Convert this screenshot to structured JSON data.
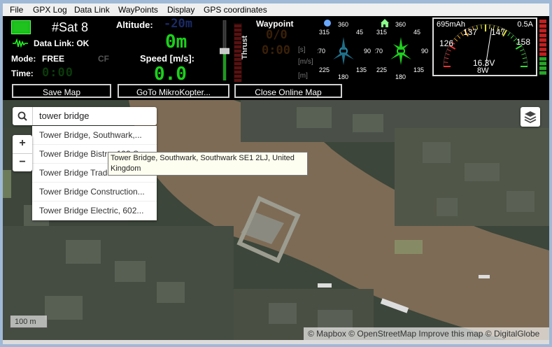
{
  "menu": [
    "File",
    "GPX Log",
    "Data Link",
    "WayPoints",
    "Display",
    "GPS coordinates"
  ],
  "status": {
    "sat": "#Sat 8",
    "data_link": "Data Link: OK",
    "mode_label": "Mode:",
    "mode_value": "FREE",
    "cf": "CF",
    "time_label": "Time:",
    "time_value": "0:00"
  },
  "altitude": {
    "label": "Altitude:",
    "bg_value": "-20m",
    "value": "0m"
  },
  "speed": {
    "label": "Speed [m/s]:",
    "value": "0.0"
  },
  "thrust_label": "Thrust",
  "waypoint": {
    "label": "Waypoint",
    "count": "0/0",
    "time": "0:00",
    "unit_s": "[s]",
    "unit_ms": "[m/s]",
    "unit_m": "[m]"
  },
  "compass_left": {
    "n": "360",
    "ne": "45",
    "e": "90",
    "se": "135",
    "s": "180",
    "sw": "225",
    "w": "270",
    "nw": "315"
  },
  "compass_right": {
    "n": "360",
    "ne": "45",
    "e": "90",
    "se": "135",
    "s": "180",
    "sw": "225",
    "w": "270",
    "nw": "315"
  },
  "battery": {
    "mah": "695mAh",
    "current": "0.5A",
    "scale": [
      "126",
      "137",
      "147",
      "158"
    ],
    "voltage": "16.3V",
    "watt": "8W",
    "gauge_fraction": 0.55
  },
  "buttons": {
    "save_map": "Save Map",
    "goto": "GoTo MikroKopter...",
    "close_map": "Close Online Map"
  },
  "search": {
    "value": "tower bridge",
    "results": [
      "Tower Bridge, Southwark,...",
      "Tower Bridge Bistro, 193 S...",
      "Tower Bridge Trade...",
      "Tower Bridge Construction...",
      "Tower Bridge Electric, 602..."
    ],
    "tooltip": "Tower Bridge, Southwark, Southwark SE1 2LJ, United Kingdom"
  },
  "zoom": {
    "in": "+",
    "out": "−"
  },
  "scale_label": "100 m",
  "attribution": "© Mapbox © OpenStreetMap Improve this map © DigitalGlobe",
  "icons": [
    "search-icon",
    "layers-icon",
    "home-icon",
    "gps-ball-icon",
    "signal-wave-icon"
  ]
}
